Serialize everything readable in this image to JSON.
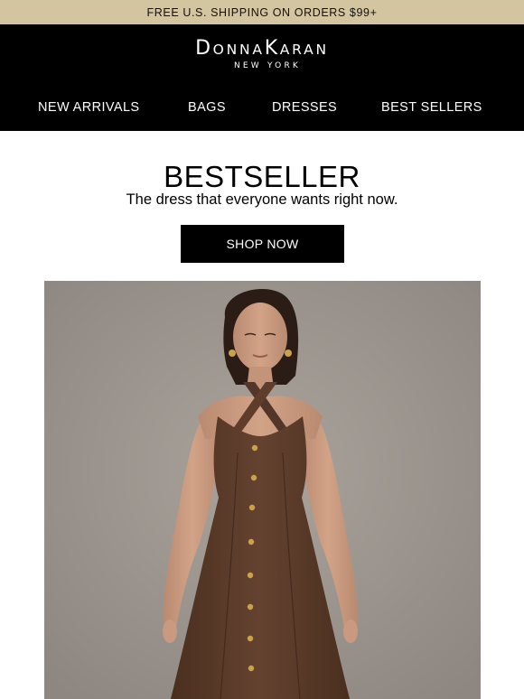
{
  "promo": {
    "text": "FREE U.S. SHIPPING ON ORDERS $99+"
  },
  "brand": {
    "name_part1_cap": "D",
    "name_part1_rest": "ONNA",
    "name_part2_cap": "K",
    "name_part2_rest": "ARAN",
    "tagline": "NEW YORK"
  },
  "nav": {
    "items": [
      {
        "label": "NEW ARRIVALS"
      },
      {
        "label": "BAGS"
      },
      {
        "label": "DRESSES"
      },
      {
        "label": "BEST SELLERS"
      }
    ]
  },
  "hero_text": {
    "headline": "BESTSELLER",
    "subline": "The dress that everyone wants right now.",
    "cta_label": "SHOP NOW"
  },
  "colors": {
    "promo_bg": "#d3c5a0",
    "header_bg": "#000000",
    "dress": "#5a3a26",
    "buttons": "#c9a24a"
  }
}
